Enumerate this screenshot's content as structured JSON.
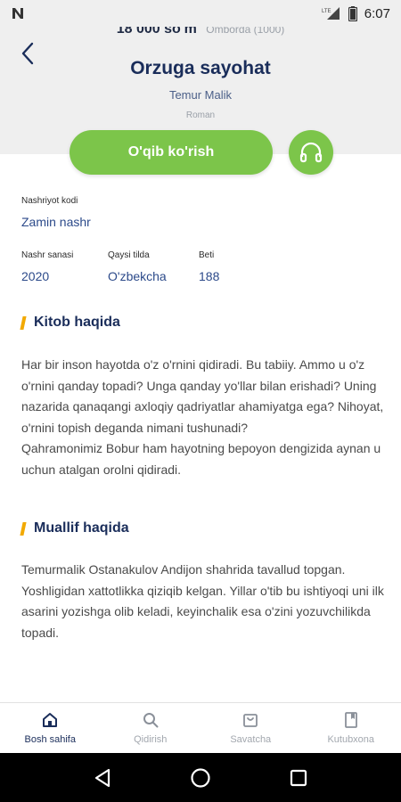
{
  "status_bar": {
    "time": "6:07",
    "carrier_icon": "n-logo-icon",
    "signal": "LTE"
  },
  "header": {
    "price": "18 000 so'm",
    "stock": "Omborda (1000)",
    "title": "Orzuga sayohat",
    "author": "Temur Malik",
    "genre": "Roman"
  },
  "actions": {
    "read_label": "O'qib ko'rish",
    "audio_icon": "headphones-icon"
  },
  "meta": {
    "publisher_label": "Nashriyot kodi",
    "publisher_value": "Zamin nashr",
    "date_label": "Nashr sanasi",
    "date_value": "2020",
    "lang_label": "Qaysi tilda",
    "lang_value": "O'zbekcha",
    "pages_label": "Beti",
    "pages_value": "188"
  },
  "about_book": {
    "title": "Kitob haqida",
    "paragraph1": "Har bir inson hayotda o'z o'rnini qidiradi. Bu tabiiy. Ammo u o'z o'rnini qanday topadi? Unga qanday yo'llar bilan erishadi? Uning nazarida qanaqangi axloqiy qadriyatlar ahamiyatga ega? Nihoyat, o'rnini topish deganda nimani tushunadi?",
    "paragraph2": "Qahramonimiz Bobur ham hayotning bepoyon dengizida aynan u uchun atalgan orolni qidiradi."
  },
  "about_author": {
    "title": "Muallif haqida",
    "paragraph": "Temurmalik Ostanakulov Andijon shahrida tavallud topgan. Yoshligidan xattotlikka qiziqib kelgan. Yillar o'tib bu ishtiyoqi uni ilk asarini yozishga olib keladi, keyinchalik esa o'zini yozuvchilikda topadi."
  },
  "bottom_nav": {
    "items": [
      {
        "label": "Bosh sahifa",
        "icon": "home-icon",
        "active": true
      },
      {
        "label": "Qidirish",
        "icon": "search-icon",
        "active": false
      },
      {
        "label": "Savatcha",
        "icon": "basket-icon",
        "active": false
      },
      {
        "label": "Kutubxona",
        "icon": "library-icon",
        "active": false
      }
    ]
  },
  "colors": {
    "accent_green": "#7cc54a",
    "navy": "#1a2d5a",
    "section_marker": "#f2a900"
  }
}
